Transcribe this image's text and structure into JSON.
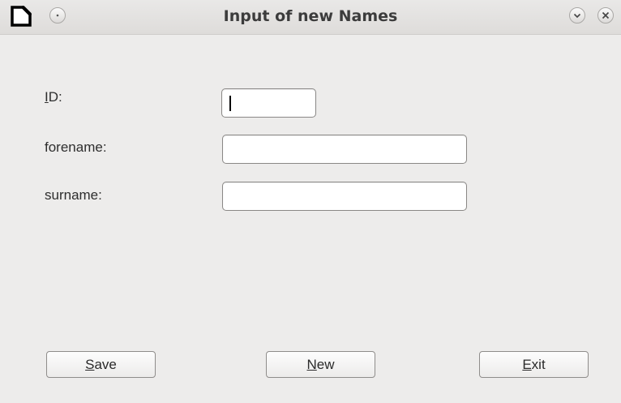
{
  "window": {
    "title": "Input of new Names"
  },
  "form": {
    "id_label_mnemonic": "I",
    "id_label_rest": "D:",
    "forename_label": "forename:",
    "surname_label": "surname:",
    "id_value": "",
    "forename_value": "",
    "surname_value": ""
  },
  "buttons": {
    "save_mnemonic": "S",
    "save_rest": "ave",
    "new_mnemonic": "N",
    "new_rest": "ew",
    "exit_mnemonic": "E",
    "exit_rest": "xit"
  },
  "icons": {
    "app": "document-logo-icon",
    "menu": "window-menu-icon",
    "minimize": "chevron-down-icon",
    "close": "close-icon"
  },
  "colors": {
    "window_bg": "#edeceb",
    "titlebar_bg": "#e2e0de",
    "input_border": "#8a8886"
  }
}
